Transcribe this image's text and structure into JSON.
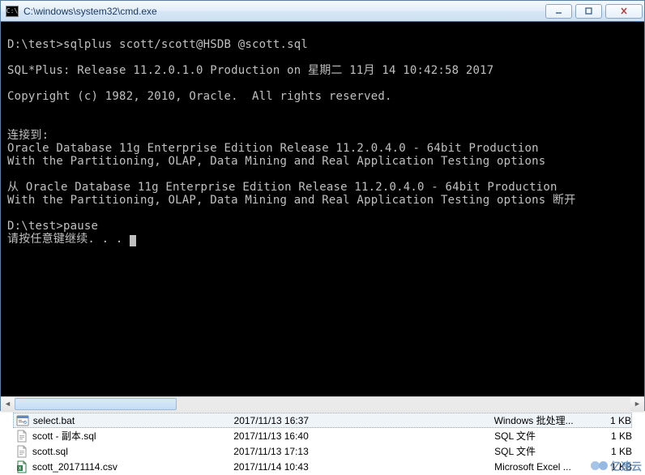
{
  "window": {
    "title": "C:\\windows\\system32\\cmd.exe",
    "icon_label": "C:\\"
  },
  "console": {
    "lines": [
      "",
      "D:\\test>sqlplus scott/scott@HSDB @scott.sql",
      "",
      "SQL*Plus: Release 11.2.0.1.0 Production on 星期二 11月 14 10:42:58 2017",
      "",
      "Copyright (c) 1982, 2010, Oracle.  All rights reserved.",
      "",
      "",
      "连接到:",
      "Oracle Database 11g Enterprise Edition Release 11.2.0.4.0 - 64bit Production",
      "With the Partitioning, OLAP, Data Mining and Real Application Testing options",
      "",
      "从 Oracle Database 11g Enterprise Edition Release 11.2.0.4.0 - 64bit Production",
      "With the Partitioning, OLAP, Data Mining and Real Application Testing options 断开",
      "",
      "D:\\test>pause",
      "请按任意键继续. . . "
    ]
  },
  "files": [
    {
      "name": "select.bat",
      "date": "2017/11/13 16:37",
      "type": "Windows 批处理...",
      "size": "1 KB",
      "icon": "bat",
      "selected": true
    },
    {
      "name": "scott - 副本.sql",
      "date": "2017/11/13 16:40",
      "type": "SQL 文件",
      "size": "1 KB",
      "icon": "sql",
      "selected": false
    },
    {
      "name": "scott.sql",
      "date": "2017/11/13 17:13",
      "type": "SQL 文件",
      "size": "1 KB",
      "icon": "sql",
      "selected": false
    },
    {
      "name": "scott_20171114.csv",
      "date": "2017/11/14 10:43",
      "type": "Microsoft Excel ...",
      "size": "1 KB",
      "icon": "csv",
      "selected": false
    }
  ],
  "watermark": {
    "text": "亿速云"
  }
}
